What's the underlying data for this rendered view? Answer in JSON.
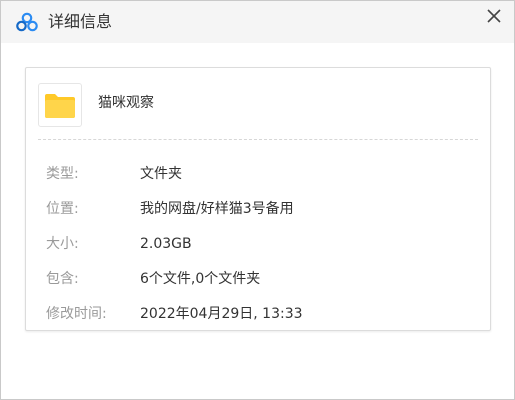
{
  "window": {
    "title": "详细信息",
    "app_icon": "baidu-netdisk-cloud-icon",
    "close_icon": "close-icon"
  },
  "file": {
    "icon": "folder-icon",
    "name": "猫咪观察"
  },
  "properties": [
    {
      "label": "类型:",
      "value": "文件夹"
    },
    {
      "label": "位置:",
      "value": "我的网盘/好样猫3号备用"
    },
    {
      "label": "大小:",
      "value": "2.03GB"
    },
    {
      "label": "包含:",
      "value": "6个文件,0个文件夹"
    },
    {
      "label": "修改时间:",
      "value": "2022年04月29日, 13:33"
    }
  ],
  "colors": {
    "accent_blue": "#2b8bf2",
    "accent_blue_dark": "#1569c7",
    "folder_yellow": "#ffc928",
    "label_gray": "#9a9a9a",
    "text_dark": "#333333"
  }
}
